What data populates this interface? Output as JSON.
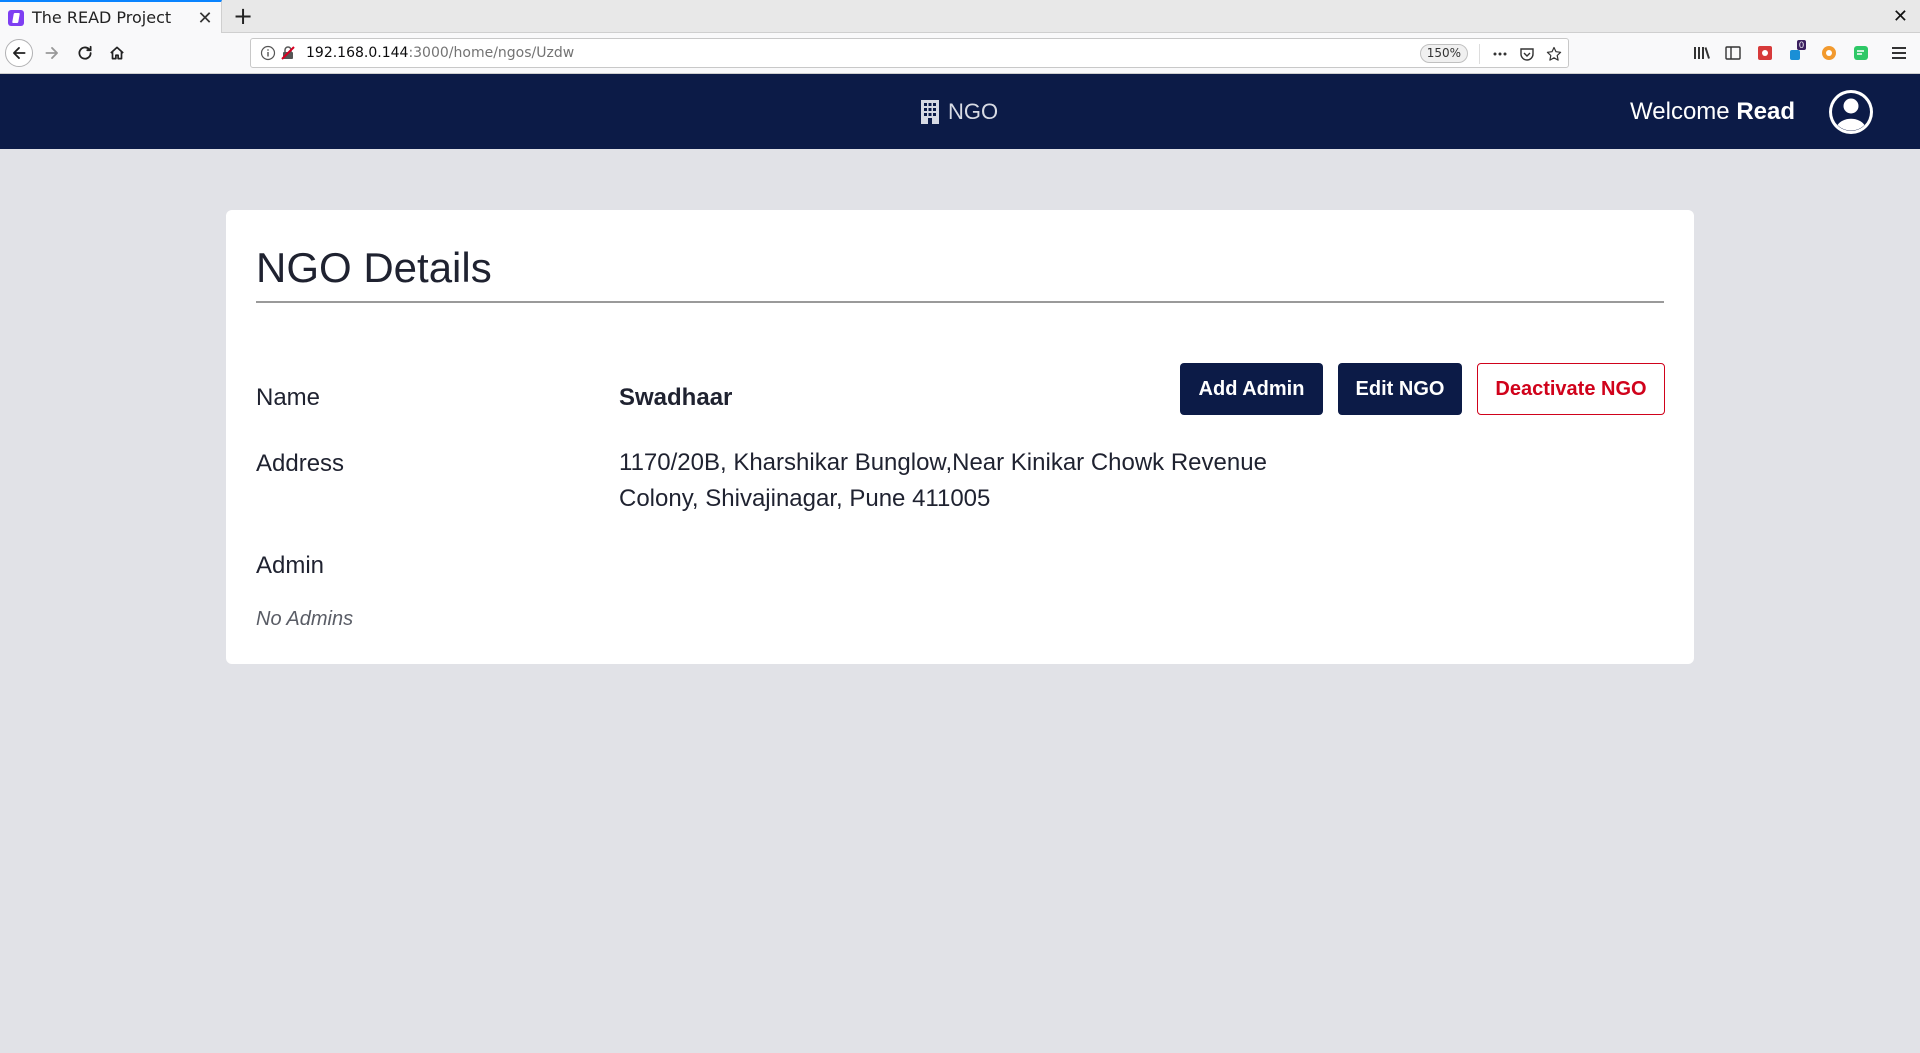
{
  "browser": {
    "tab_title": "The READ Project",
    "tab_close": "✕",
    "new_tab": "+",
    "window_close": "✕",
    "url_host": "192.168.0.144",
    "url_path": ":3000/home/ngos/Uzdw",
    "zoom": "150%",
    "extension_badge": "0"
  },
  "header": {
    "title": "NGO",
    "welcome_prefix": "Welcome ",
    "user_name": "Read"
  },
  "card": {
    "title": "NGO Details",
    "fields": {
      "name_label": "Name",
      "name_value": "Swadhaar",
      "address_label": "Address",
      "address_value": "1170/20B, Kharshikar Bunglow,Near Kinikar Chowk Revenue Colony, Shivajinagar, Pune 411005",
      "admin_label": "Admin",
      "admin_empty": "No Admins"
    },
    "buttons": {
      "add_admin": "Add Admin",
      "edit_ngo": "Edit NGO",
      "deactivate_ngo": "Deactivate NGO"
    }
  },
  "colors": {
    "header_bg": "#0c1b47",
    "page_bg": "#e1e2e7",
    "danger": "#d0021b"
  }
}
